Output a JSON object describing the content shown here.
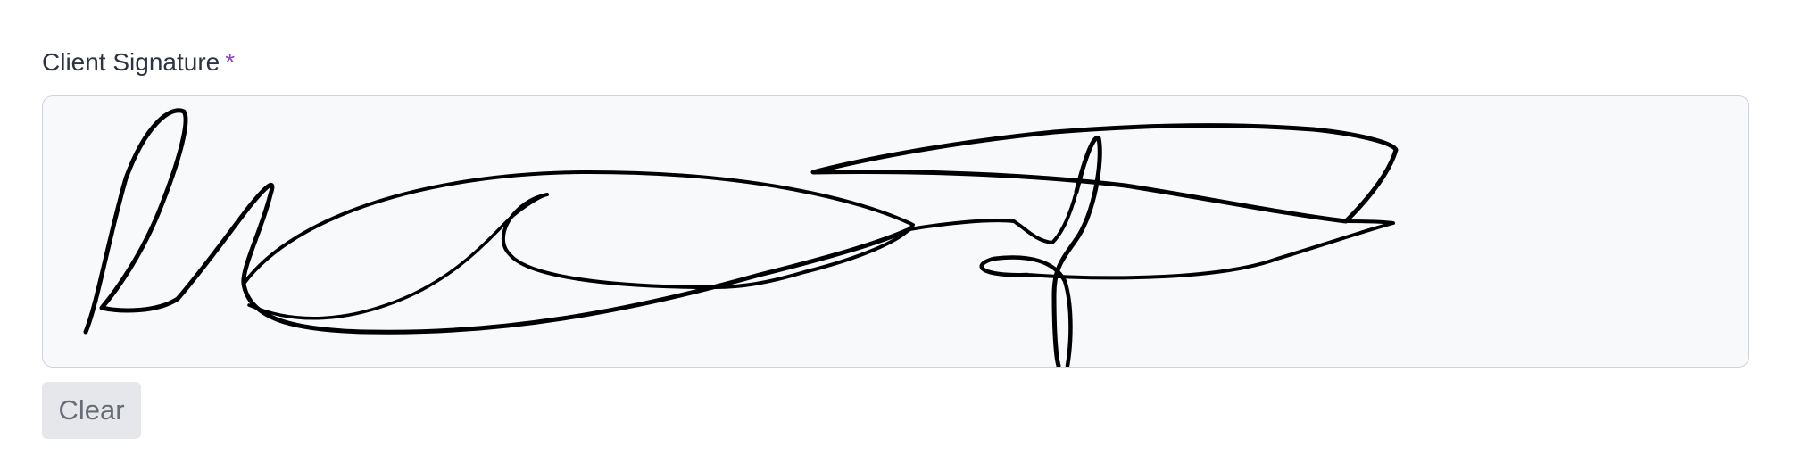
{
  "field": {
    "label": "Client Signature",
    "required_marker": "*"
  },
  "signature_pad": {
    "has_signature": true,
    "stroke_color": "#000000",
    "background_color": "#f8f9fb"
  },
  "actions": {
    "clear_label": "Clear"
  },
  "colors": {
    "required_accent": "#8e44c9",
    "label_text": "#2d3340",
    "button_background": "#e6e7ea",
    "button_text": "#676c76"
  }
}
